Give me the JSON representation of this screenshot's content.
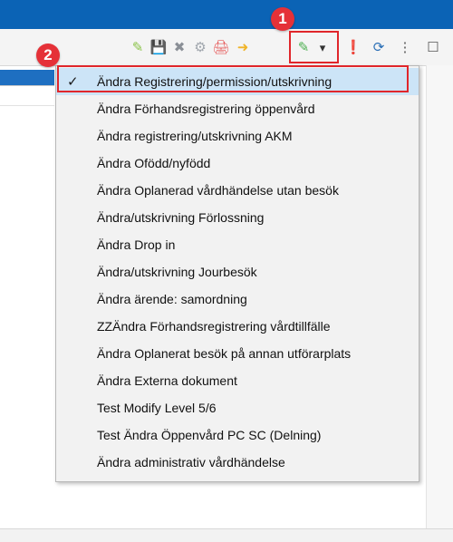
{
  "callouts": [
    "1",
    "2"
  ],
  "toolbar": {
    "icons": [
      "edit-icon",
      "save-icon",
      "delete-icon",
      "settings-icon",
      "print-icon",
      "export-icon",
      "modify-icon",
      "dropdown-arrow-icon",
      "alert-doc-icon",
      "refresh-icon",
      "more-options-icon",
      "window-icon"
    ],
    "glyphs": [
      "✎",
      "💾",
      "✖",
      "⚙",
      "🖨",
      "➜",
      "✎",
      "▾",
      "❗",
      "⟳",
      "⋮",
      "☐"
    ],
    "colors": [
      "#8bc34a",
      "#9aa0a6",
      "#8a8f96",
      "#a0a6ad",
      "#e65a5a",
      "#f0b429",
      "#4caf50",
      "#333333",
      "#d9534f",
      "#2b6fb6",
      "#555555",
      "#555555"
    ]
  },
  "menu": {
    "items": [
      {
        "label": "Ändra Registrering/permission/utskrivning",
        "checked": true
      },
      {
        "label": "Ändra Förhandsregistrering öppenvård",
        "checked": false
      },
      {
        "label": "Ändra registrering/utskrivning AKM",
        "checked": false
      },
      {
        "label": "Ändra Ofödd/nyfödd",
        "checked": false
      },
      {
        "label": "Ändra Oplanerad vårdhändelse utan besök",
        "checked": false
      },
      {
        "label": "Ändra/utskrivning Förlossning",
        "checked": false
      },
      {
        "label": "Ändra Drop in",
        "checked": false
      },
      {
        "label": "Ändra/utskrivning Jourbesök",
        "checked": false
      },
      {
        "label": "Ändra ärende: samordning",
        "checked": false
      },
      {
        "label": "ZZÄndra Förhandsregistrering vårdtillfälle",
        "checked": false
      },
      {
        "label": "Ändra Oplanerat besök på annan utförarplats",
        "checked": false
      },
      {
        "label": "Ändra Externa dokument",
        "checked": false
      },
      {
        "label": "Test Modify Level 5/6",
        "checked": false
      },
      {
        "label": "Test Ändra Öppenvård PC SC (Delning)",
        "checked": false
      },
      {
        "label": "Ändra administrativ vårdhändelse",
        "checked": false
      }
    ]
  },
  "colors": {
    "titlebar": "#0b63b5",
    "highlight": "#e0262b",
    "badge": "#e53138",
    "checked_bg": "#cce4f7"
  }
}
